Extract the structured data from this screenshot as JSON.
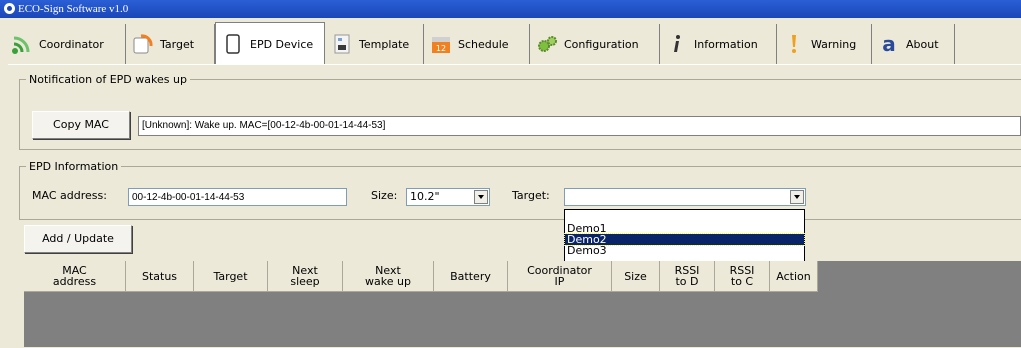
{
  "window": {
    "title": "ECO-Sign Software v1.0"
  },
  "tabs": [
    {
      "label": "Coordinator",
      "icon": "wifi-signal-icon"
    },
    {
      "label": "Target",
      "icon": "target-device-icon"
    },
    {
      "label": "EPD Device",
      "icon": "epd-device-icon"
    },
    {
      "label": "Template",
      "icon": "template-icon"
    },
    {
      "label": "Schedule",
      "icon": "calendar-icon"
    },
    {
      "label": "Configuration",
      "icon": "gears-icon"
    },
    {
      "label": "Information",
      "icon": "info-icon"
    },
    {
      "label": "Warning",
      "icon": "exclamation-icon"
    },
    {
      "label": "About",
      "icon": "about-a-icon"
    }
  ],
  "active_tab": "EPD Device",
  "notification": {
    "legend": "Notification of EPD wakes up",
    "copy_button": "Copy MAC",
    "message": "[Unknown]: Wake up. MAC=[00-12-4b-00-01-14-44-53]"
  },
  "epd_info": {
    "legend": "EPD Information",
    "mac_label": "MAC address:",
    "mac_value": "00-12-4b-00-01-14-44-53",
    "size_label": "Size:",
    "size_value": "10.2\"",
    "target_label": "Target:",
    "target_value": "",
    "target_options": [
      "",
      "Demo1",
      "Demo2",
      "Demo3"
    ],
    "target_highlighted": "Demo2"
  },
  "add_update_button": "Add / Update",
  "table": {
    "columns": [
      "MAC\naddress",
      "Status",
      "Target",
      "Next\nsleep",
      "Next\nwake up",
      "Battery",
      "Coordinator\nIP",
      "Size",
      "RSSI\nto D",
      "RSSI\nto C",
      "Action"
    ],
    "rows": []
  },
  "colors": {
    "titlebar": "#1a46b8",
    "selection": "#0a246a",
    "window_bg": "#ece9d8",
    "table_bg": "#808080"
  }
}
